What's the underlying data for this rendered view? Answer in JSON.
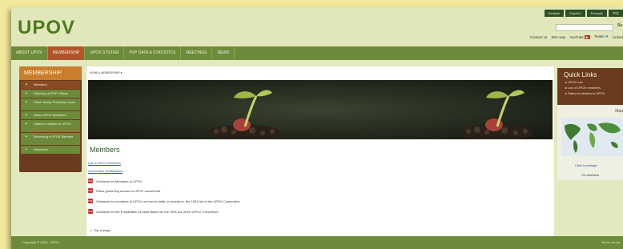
{
  "header": {
    "logo": "UPOV",
    "languages": [
      "Deutsch",
      "Español",
      "Français",
      "中文"
    ],
    "search_button": "Se",
    "toplinks": {
      "contact": "Contact us",
      "sitemap": "Site map",
      "youtube": "YouTube",
      "twitter": "Twitter",
      "linkedin": "Linked"
    }
  },
  "nav": {
    "items": [
      "ABOUT UPOV",
      "MEMBERSHIP",
      "UPOV SYSTEM",
      "PVP DATA & STATISTICS",
      "MEETINGS",
      "NEWS"
    ],
    "active_index": 1
  },
  "left_nav": {
    "header": "MEMBERSHIP",
    "items": [
      "Members",
      "Directory of PVP Offices",
      "Plant Variety Protection Laws",
      "About UPOV Members",
      "Status in relation to UPOV",
      "Becoming a UPOV Member",
      "Observers"
    ]
  },
  "main": {
    "breadcrumb": "HOME ▸ MEMBERSHIP ▾",
    "title": "Members",
    "links": [
      "List of UPOV Members",
      "Convention Notifications"
    ],
    "documents": [
      "Guidance for Members of UPOV",
      "Rules governing access to UPOV documents",
      "Guidance for members of UPOV on how to ratify, or accede to, the 1991 Act of the UPOV Convention",
      "Guidance for the Preparation of Laws Based on the 1991 Act of the UPOV Convention"
    ],
    "top_of_page": "Top of page"
  },
  "quick_links": {
    "title": "Quick Links",
    "items": [
      "UPOV Lex",
      "List of UPOV members",
      "Status in relation to UPOV"
    ]
  },
  "map": {
    "title": "Map",
    "enlarge": "Click to enlarge",
    "members": "75 members"
  },
  "footer": {
    "copyright": "Copyright © 2015 - UPOV",
    "terms": "Terms of use"
  },
  "colors": {
    "accent": "#b3552a",
    "nav": "#6d8b3b",
    "brown": "#6b3b1e",
    "logo": "#4c7a1f"
  }
}
